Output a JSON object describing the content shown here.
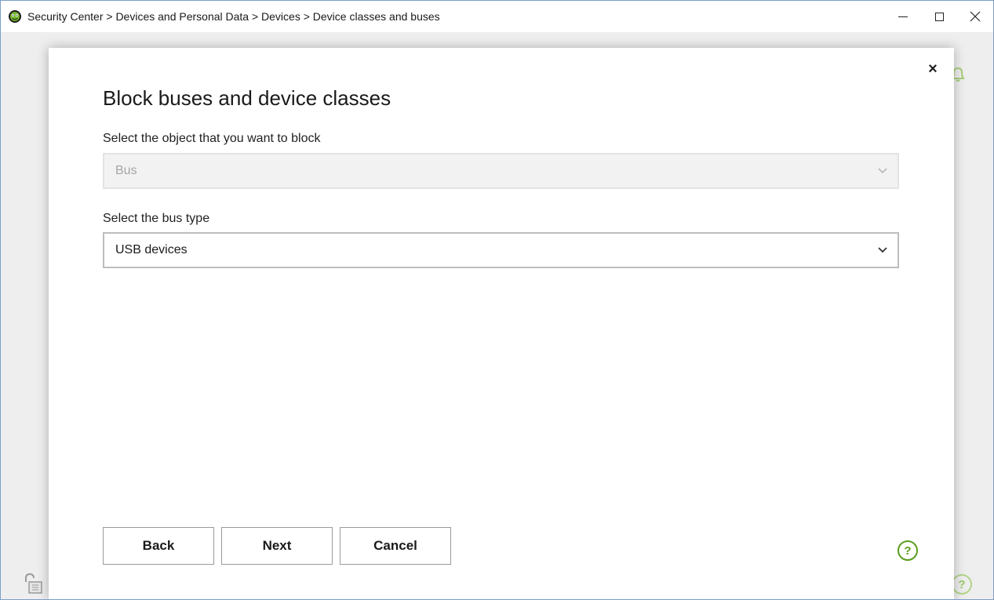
{
  "window": {
    "title": "Security Center > Devices and Personal Data > Devices > Device classes and buses",
    "app_icon": "dr-web-spider-icon",
    "controls": {
      "minimize_label": "—",
      "maximize_label": "☐",
      "close_label": "✕"
    }
  },
  "background": {
    "help_label": "?",
    "icons": [
      "bell-icon",
      "lock-icon",
      "help-icon"
    ]
  },
  "dialog": {
    "close_label": "×",
    "title": "Block buses and device classes",
    "object_field": {
      "label": "Select the object that you want to block",
      "value": "Bus",
      "disabled": true
    },
    "bus_field": {
      "label": "Select the bus type",
      "value": "USB devices"
    },
    "buttons": {
      "back": "Back",
      "next": "Next",
      "cancel": "Cancel"
    },
    "help_label": "?"
  },
  "colors": {
    "accent_green": "#5a9e1e",
    "window_border": "#7a9ec7"
  }
}
